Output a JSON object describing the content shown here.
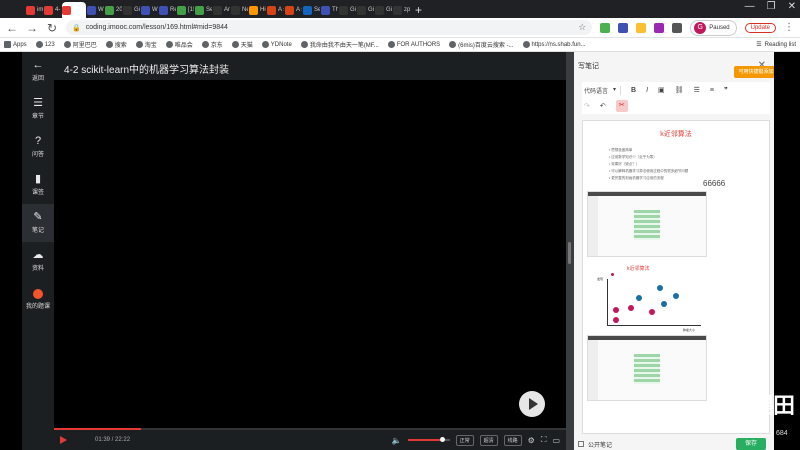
{
  "browser": {
    "tabs": [
      {
        "label": "imo",
        "color": "#e53935"
      },
      {
        "label": "4-",
        "color": "#e53935"
      },
      {
        "label": "",
        "color": "#e53935",
        "active": true
      },
      {
        "label": "Wi",
        "color": "#3f51b5"
      },
      {
        "label": "20",
        "color": "#43a047"
      },
      {
        "label": "Git",
        "color": "#333333"
      },
      {
        "label": "Wi",
        "color": "#3f51b5"
      },
      {
        "label": "Re",
        "color": "#3f51b5"
      },
      {
        "label": "[1!",
        "color": "#43a047"
      },
      {
        "label": "Se",
        "color": "#43a047"
      },
      {
        "label": "An",
        "color": "#333333"
      },
      {
        "label": "Ne",
        "color": "#333333"
      },
      {
        "label": "Hi",
        "color": "#ff9800"
      },
      {
        "label": "A s",
        "color": "#d84315"
      },
      {
        "label": "A s",
        "color": "#d84315"
      },
      {
        "label": "Se",
        "color": "#1565c0"
      },
      {
        "label": "Th",
        "color": "#3f51b5"
      },
      {
        "label": "Git",
        "color": "#333333"
      },
      {
        "label": "Git",
        "color": "#333333"
      },
      {
        "label": "Git",
        "color": "#333333"
      },
      {
        "label": "zp",
        "color": "#333333"
      }
    ],
    "new_tab": "+",
    "url": "coding.imooc.com/lesson/169.html#mid=9844",
    "paused_label": "Paused",
    "profile_initial": "G",
    "update_label": "Update",
    "bookmarks": [
      "Apps",
      "123",
      "阿里巴巴",
      "搜索",
      "淘宝",
      "唯品会",
      "京东",
      "天猫",
      "YDNote",
      "我命由我不由天一笔(MF...",
      "FOR AUTHORS",
      "(6mis)百度云搜索 -...",
      "https://ns.shab.fun..."
    ],
    "reading_list": "Reading list"
  },
  "sidebar": {
    "items": [
      {
        "icon": "←",
        "label": "返回"
      },
      {
        "icon": "☰",
        "label": "章节"
      },
      {
        "icon": "?",
        "label": "问答"
      },
      {
        "icon": "▮",
        "label": "课签"
      },
      {
        "icon": "✎",
        "label": "笔记"
      },
      {
        "icon": "☁",
        "label": "资料"
      },
      {
        "icon": "",
        "label": "我的题课"
      }
    ]
  },
  "video": {
    "title": "4-2 scikit-learn中的机器学习算法封装",
    "progress": 0.17,
    "time": "01:39 / 22:22",
    "volume": 0.82,
    "buttons": [
      "正常",
      "超清",
      "线路"
    ]
  },
  "notes": {
    "title": "写笔记",
    "tag": "可用快捷键添加",
    "toolbar": {
      "code_lang": "代码语言",
      "bold": "B",
      "italic": "I",
      "image": "▣",
      "link": "⛓",
      "ul": "☰",
      "ol": "≡",
      "quote": "❞",
      "redo": "↷",
      "undo": "↶",
      "clear": "✂"
    },
    "content": {
      "heading": "k近邻算法",
      "list": [
        "思想极度简单",
        "应用数学知识少（近乎为零）",
        "效果好（缺点？）",
        "可以解释机器学习算法使用过程中的很多细节问题",
        "更完整的刻画机器学习应用的流程"
      ],
      "number": "66666",
      "knn_title": "k近邻算法",
      "ylabel": "发现",
      "xlabel": "肿瘤大小"
    },
    "public_label": "公开笔记",
    "save_label": "保存"
  },
  "watermark": {
    "text": "唱田",
    "num": "684"
  }
}
